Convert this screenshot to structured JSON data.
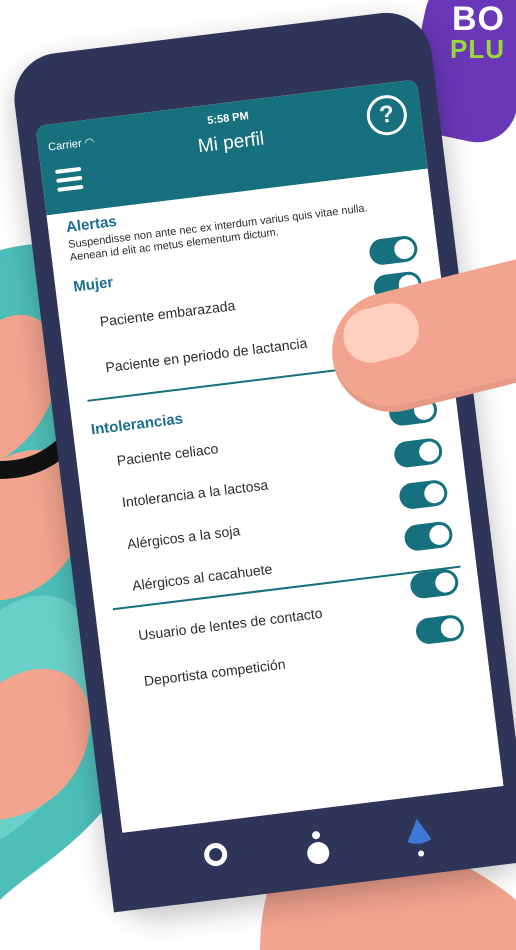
{
  "status_bar": {
    "carrier": "Carrier",
    "time": "5:58 PM"
  },
  "header": {
    "title": "Mi perfil",
    "help_label": "?"
  },
  "sections": {
    "alertas": {
      "title": "Alertas",
      "description": "Suspendisse non ante nec ex interdum varius quis vitae nulla. Aenean id elit ac metus elementum dictum."
    },
    "mujer": {
      "title": "Mujer",
      "items": [
        {
          "label": "Paciente embarazada",
          "on": true
        },
        {
          "label": "Paciente en periodo de lactancia",
          "on": true
        }
      ]
    },
    "intolerancias": {
      "title": "Intolerancias",
      "items": [
        {
          "label": "Paciente celiaco",
          "on": true
        },
        {
          "label": "Intolerancia a la lactosa",
          "on": true
        },
        {
          "label": "Alérgicos a la soja",
          "on": true
        },
        {
          "label": "Alérgicos al cacahuete",
          "on": true
        }
      ]
    },
    "otros": {
      "items": [
        {
          "label": "Usuario de lentes de contacto",
          "on": true
        },
        {
          "label": "Deportista competición",
          "on": true
        }
      ]
    }
  },
  "badge": {
    "line1": "BO",
    "line2": "PLU"
  },
  "colors": {
    "header": "#16707d",
    "section_title": "#1a6f8f",
    "toggle_on": "#16707d",
    "phone_frame": "#2f3558",
    "background_teal": "#3bb7b1",
    "hand": "#f2a48e",
    "badge": "#6a37b8",
    "badge_accent": "#9bd83b"
  },
  "tabs": [
    {
      "icon": "ring-icon",
      "active": false
    },
    {
      "icon": "bottle-icon",
      "active": false
    },
    {
      "icon": "drop-icon",
      "active": true
    }
  ]
}
